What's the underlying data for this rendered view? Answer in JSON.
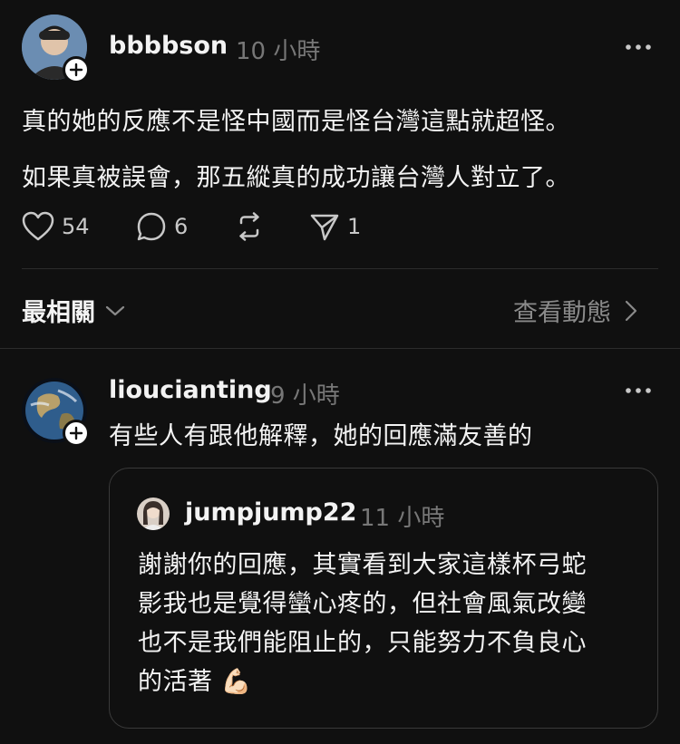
{
  "main_post": {
    "username": "bbbbson",
    "time": "10 小時",
    "lines": [
      "真的她的反應不是怪中國而是怪台灣這點就超怪。",
      "如果真被誤會，那五縱真的成功讓台灣人對立了。"
    ],
    "likes": "54",
    "comments": "6",
    "shares": "1"
  },
  "sort_bar": {
    "label": "最相關",
    "activity_label": "查看動態"
  },
  "reply": {
    "username": "lioucianting",
    "time": "9 小時",
    "text": "有些人有跟他解釋，她的回應滿友善的",
    "quote": {
      "username": "jumpjump22",
      "time": "11 小時",
      "lines": [
        "謝謝你的回應，其實看到大家這樣杯弓蛇",
        "影我也是覺得蠻心疼的，但社會風氣改變",
        "也不是我們能阻止的，只能努力不負良心",
        "的活著"
      ],
      "emoji": "💪🏻"
    }
  },
  "colors": {
    "background": "#101010",
    "text": "#f3f3f3",
    "secondary": "#777777",
    "divider": "#2c2c2c"
  }
}
